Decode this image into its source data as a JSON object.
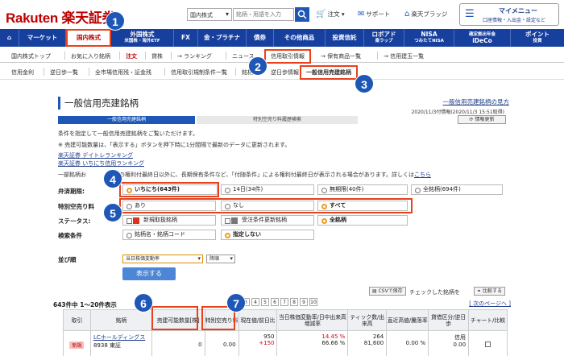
{
  "header": {
    "logo": "Rakuten 楽天証券",
    "market_select": "国内株式",
    "search_placeholder": "銘柄・用語を入力",
    "links": {
      "order": "注文",
      "support": "サポート",
      "community": "楽天ブラッジ"
    },
    "mypage_title": "マイメニュー",
    "mypage_sub": "口座情報・入出金・設定など"
  },
  "mainnav": [
    "マーケット",
    "国内株式",
    "外国株式",
    "米国株・海外ETF",
    "FX",
    "金・プラチナ",
    "債券",
    "その他商品",
    "投資信託",
    "ロボアド",
    "楽ラップ",
    "NISA",
    "つみたてNISA",
    "確定拠出年金",
    "iDeCo",
    "ポイント",
    "投資"
  ],
  "subnav": [
    "国内株式トップ",
    "お気に入り銘柄",
    "注文",
    "貸株",
    "→ ランキング",
    "ニュース",
    "信用取引情報",
    "→ 保有商品一覧",
    "→ 信用建玉一覧"
  ],
  "subnav2": [
    "信用金利",
    "逆日歩一覧",
    "全市場信用残・証金残",
    "信用取引規制条件一覧",
    "銘柄",
    "逆日歩情報",
    "一般信用売建銘柄"
  ],
  "page": {
    "title": "一般信用売建銘柄",
    "guide_link": "一般信用売建銘柄の見方",
    "update_info": "2020/11/3付情報(2020/11/3 15:51取得)",
    "tabs": [
      "一般信用売建銘柄",
      "特別空売り料履歴検索"
    ],
    "refresh": "情報更新",
    "desc1": "条件を指定して一般信用売建銘柄をご覧いただけます。",
    "desc2": "※ 売建可能数量は、「表示する」ボタンを押下時に1分間隔で最新のデータに更新されます。",
    "link1": "楽天証券 デイトレランキング",
    "link2": "楽天証券 いちにち信用ランキング",
    "desc3a": "一部銘柄お",
    "desc3b": "常の権利付最終日以外に、長期保有条件など、「付随条件」による権利付最終日が表示される場合があります。詳しくは",
    "desc3_link": "こちら"
  },
  "filters": {
    "period_label": "弁済期限:",
    "period_options": [
      "いちにち(643件)",
      "14日(34件)",
      "無期限(40件)",
      "全銘柄(694件)"
    ],
    "short_label": "特別空売り料",
    "short_options": [
      "あり",
      "なし",
      "すべて"
    ],
    "status_label": "ステータス:",
    "status_options": [
      "新規取扱銘柄",
      "受注条件更新銘柄",
      "全銘柄"
    ],
    "search_label": "検索条件",
    "search_options": [
      "銘柄名・銘柄コード",
      "指定しない"
    ],
    "sort_label": "並び順",
    "sort_value": "当日株価変動率",
    "sort_dir": "降順",
    "show_button": "表示する"
  },
  "results": {
    "count": "643件中 1〜20件表示",
    "pages": [
      "3",
      "4",
      "5",
      "6",
      "7",
      "8",
      "9",
      "10"
    ],
    "next": "次のページへ",
    "csv": "CSVで保存",
    "check_label": "チェックした銘柄を",
    "compare": "比較する",
    "headers": [
      "取引",
      "銘柄",
      "売建可能数量[株]",
      "特別空売り料",
      "現在値/前日比",
      "当日株価変動率/日中出来高増減率",
      "ティック数/出来高",
      "直近高値/騰落率",
      "貸借区分/逆日歩",
      "チャート/比較"
    ],
    "rows": [
      {
        "badge": "新規",
        "name": "LCホールディングス",
        "code": "8938 東証",
        "qty": "0",
        "fee": "0.00",
        "price": "950",
        "change": "+150",
        "rate": "14.45 %",
        "vol_rate": "66.66 %",
        "tick": "264",
        "volume": "81,600",
        "high": "",
        "high_rate": "0.00 %",
        "lend": "信用",
        "gyaku": "0.00"
      }
    ]
  },
  "callouts": [
    "1",
    "2",
    "3",
    "4",
    "5",
    "6",
    "7"
  ],
  "colors": {
    "accent": "#bf0000",
    "nav": "#163f9e",
    "highlight": "#e8411c",
    "callout": "#1f57b6"
  }
}
